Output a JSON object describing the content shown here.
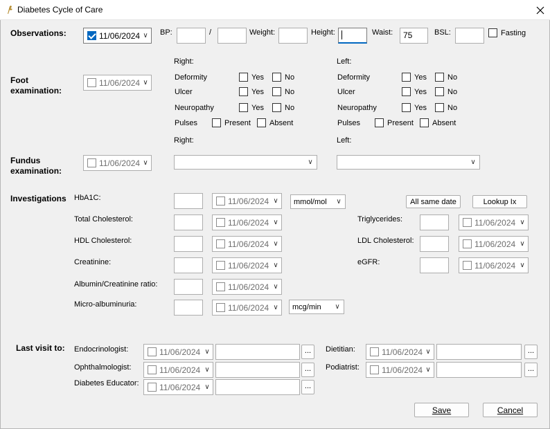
{
  "window": {
    "title": "Diabetes Cycle of Care",
    "close_glyph": "✕",
    "app_icon": "app-icon"
  },
  "observations": {
    "heading": "Observations:",
    "date": "11/06/2024",
    "date_checked": true,
    "bp_label": "BP:",
    "bp_separator": "/",
    "bp_systolic": "",
    "bp_diastolic": "",
    "weight_label": "Weight:",
    "weight": "",
    "height_label": "Height:",
    "height": "",
    "waist_label": "Waist:",
    "waist": "75",
    "bsl_label": "BSL:",
    "bsl": "",
    "fasting_label": "Fasting",
    "fasting_checked": false
  },
  "foot_exam": {
    "heading_line1": "Foot",
    "heading_line2": "examination:",
    "date": "11/06/2024",
    "right_label": "Right:",
    "left_label": "Left:",
    "rows": {
      "deformity": "Deformity",
      "ulcer": "Ulcer",
      "neuropathy": "Neuropathy",
      "pulses": "Pulses"
    },
    "yes": "Yes",
    "no": "No",
    "present": "Present",
    "absent": "Absent"
  },
  "fundus_exam": {
    "heading_line1": "Fundus",
    "heading_line2": "examination:",
    "date": "11/06/2024",
    "right_label": "Right:",
    "left_label": "Left:",
    "right_value": "",
    "left_value": ""
  },
  "investigations": {
    "heading": "Investigations",
    "hba1c_label": "HbA1C:",
    "hba1c_unit": "mmol/mol",
    "all_same_date": "All same date",
    "lookup": "Lookup Ix",
    "total_cholesterol_label": "Total Cholesterol:",
    "hdl_label": "HDL Cholesterol:",
    "creatinine_label": "Creatinine:",
    "albumin_label": "Albumin/Creatinine ratio:",
    "micro_label": "Micro-albuminuria:",
    "micro_unit": "mcg/min",
    "triglycerides_label": "Triglycerides:",
    "ldl_label": "LDL Cholesterol:",
    "egfr_label": "eGFR:",
    "date": "11/06/2024"
  },
  "last_visit": {
    "heading": "Last visit to:",
    "endocrinologist": "Endocrinologist:",
    "ophthalmologist": "Ophthalmologist:",
    "educator": "Diabetes Educator:",
    "dietitian": "Dietitian:",
    "podiatrist": "Podiatrist:",
    "date": "11/06/2024",
    "ellipsis": "..."
  },
  "buttons": {
    "save": "Save",
    "cancel": "Cancel"
  },
  "colors": {
    "accent": "#0067c0",
    "window_bg": "#f0f0f0"
  }
}
